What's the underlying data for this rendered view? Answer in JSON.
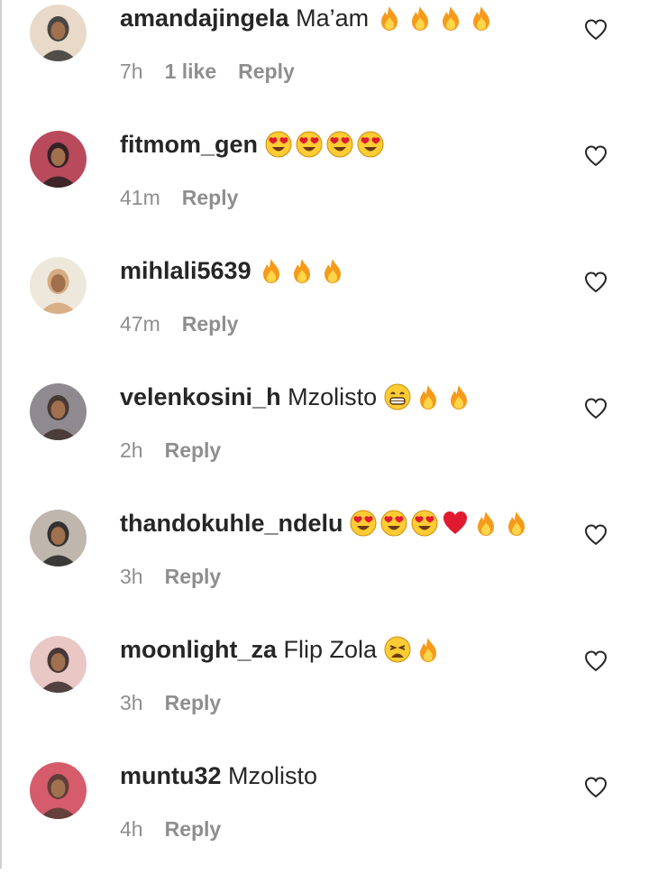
{
  "comments": [
    {
      "username": "amandajingela",
      "text": "Ma’am",
      "emojis": [
        "fire",
        "fire",
        "fire",
        "fire"
      ],
      "time": "7h",
      "likes": "1 like",
      "reply": "Reply",
      "avatar_color": "#2b2b2b",
      "avatar_bg": "#e8d9c8"
    },
    {
      "username": "fitmom_gen",
      "text": "",
      "emojis": [
        "heart-eyes",
        "heart-eyes",
        "heart-eyes",
        "heart-eyes"
      ],
      "time": "41m",
      "likes": "",
      "reply": "Reply",
      "avatar_color": "#1e1b1b",
      "avatar_bg": "#b84a5c"
    },
    {
      "username": "mihlali5639",
      "text": "",
      "emojis": [
        "fire",
        "fire",
        "fire"
      ],
      "time": "47m",
      "likes": "",
      "reply": "Reply",
      "avatar_color": "#d2a071",
      "avatar_bg": "#eee8dc"
    },
    {
      "username": "velenkosini_h",
      "text": "Mzolisto",
      "emojis": [
        "grin",
        "fire",
        "fire"
      ],
      "time": "2h",
      "likes": "",
      "reply": "Reply",
      "avatar_color": "#3a2a24",
      "avatar_bg": "#8f8a8f"
    },
    {
      "username": "thandokuhle_ndelu",
      "text": "",
      "emojis": [
        "heart-eyes",
        "heart-eyes",
        "heart-eyes",
        "red-heart",
        "fire",
        "fire"
      ],
      "time": "3h",
      "likes": "",
      "reply": "Reply",
      "avatar_color": "#1a1a1a",
      "avatar_bg": "#bfb6ae"
    },
    {
      "username": "moonlight_za",
      "text": "Flip Zola",
      "emojis": [
        "weary",
        "fire"
      ],
      "time": "3h",
      "likes": "",
      "reply": "Reply",
      "avatar_color": "#2a1f1f",
      "avatar_bg": "#e9c7c5"
    },
    {
      "username": "muntu32",
      "text": "Mzolisto",
      "emojis": [],
      "time": "4h",
      "likes": "",
      "reply": "Reply",
      "avatar_color": "#4a3a2f",
      "avatar_bg": "#d65b6b"
    }
  ],
  "colors": {
    "text": "#262626",
    "meta": "#8e8e8e",
    "fire_outer": "#f59a1b",
    "fire_inner": "#ffd54a",
    "emoji_face": "#ffcc33",
    "heart_red": "#e01b2f"
  }
}
